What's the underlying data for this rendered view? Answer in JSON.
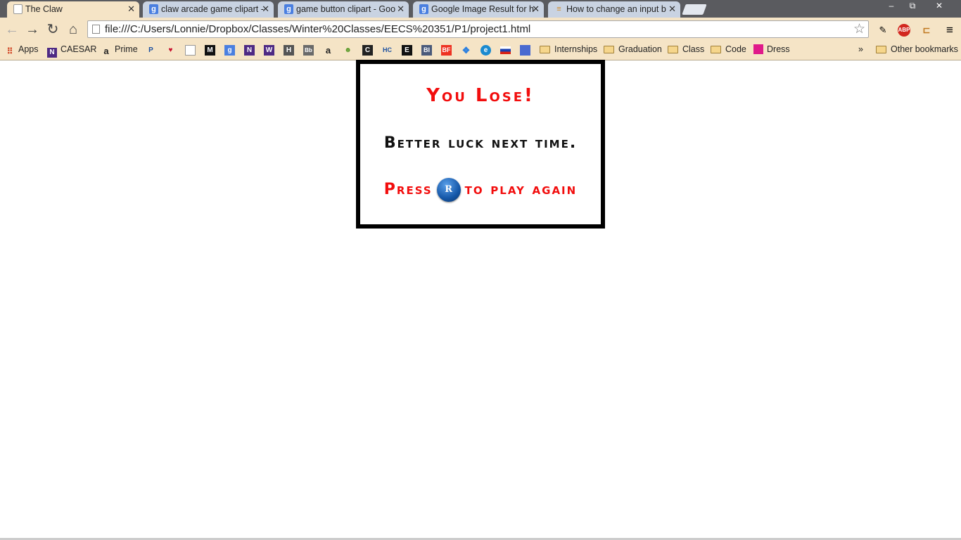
{
  "browser": {
    "tabs": [
      {
        "title": "The Claw",
        "icon": "document-icon",
        "active": true
      },
      {
        "title": "claw arcade game clipart -",
        "icon": "google-icon"
      },
      {
        "title": "game button clipart - Goo",
        "icon": "google-icon"
      },
      {
        "title": "Google Image Result for h",
        "icon": "google-icon"
      },
      {
        "title": "How to change an input b",
        "icon": "stackoverflow-icon"
      }
    ],
    "window_controls": {
      "minimize": "–",
      "restore": "⧉",
      "close": "✕"
    },
    "url": "file:///C:/Users/Lonnie/Dropbox/Classes/Winter%20Classes/EECS%20351/P1/project1.html",
    "extensions": {
      "abp_label": "ABP"
    },
    "bookmarks": {
      "apps": "Apps",
      "caesar": "CAESAR",
      "prime": "Prime",
      "folders": [
        "Internships",
        "Graduation",
        "Class",
        "Code"
      ],
      "dress": "Dress",
      "overflow": "»",
      "other": "Other bookmarks"
    }
  },
  "game": {
    "title": "You Lose!",
    "subtitle": "Better luck next time.",
    "press_label": "Press",
    "key_label": "R",
    "again_label": "to play again"
  },
  "colors": {
    "accent_red": "#f20d0d",
    "chrome_tan": "#f5e4c6",
    "button_blue": "#1557a8"
  }
}
